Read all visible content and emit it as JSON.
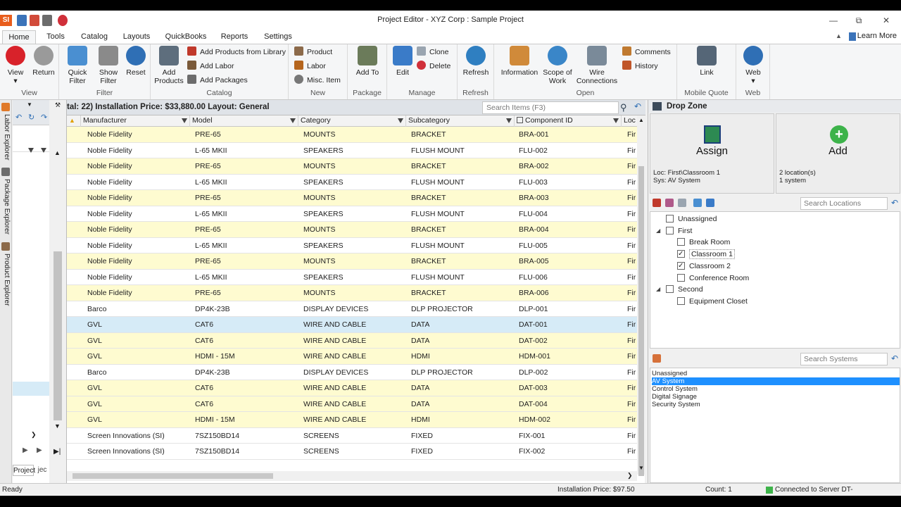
{
  "window": {
    "title": "Project Editor - XYZ Corp : Sample Project",
    "logo_text": "SI",
    "learn_more": "Learn More"
  },
  "tabs": [
    "Home",
    "Tools",
    "Catalog",
    "Layouts",
    "QuickBooks",
    "Reports",
    "Settings"
  ],
  "ribbon": {
    "view": {
      "view": "View",
      "return": "Return",
      "group": "View"
    },
    "filter": {
      "quick": "Quick Filter",
      "show": "Show Filter",
      "reset": "Reset",
      "group": "Filter"
    },
    "catalog": {
      "add_products": "Add Products",
      "from_library": "Add Products from Library",
      "add_labor": "Add Labor",
      "add_packages": "Add Packages",
      "group": "Catalog"
    },
    "new": {
      "product": "Product",
      "labor": "Labor",
      "misc": "Misc. Item",
      "group": "New"
    },
    "package": {
      "add_to": "Add To",
      "group": "Package"
    },
    "manage": {
      "edit": "Edit",
      "clone": "Clone",
      "delete": "Delete",
      "group": "Manage"
    },
    "refresh": {
      "refresh": "Refresh",
      "group": "Refresh"
    },
    "open": {
      "information": "Information",
      "scope": "Scope of Work",
      "wire": "Wire Connections",
      "comments": "Comments",
      "history": "History",
      "group": "Open"
    },
    "mobile": {
      "link": "Link",
      "group": "Mobile Quote"
    },
    "web": {
      "web": "Web",
      "group": "Web"
    }
  },
  "left_tabs": [
    "Labor Explorer",
    "Package Explorer",
    "Product Explorer"
  ],
  "left_bottom_tabs": [
    "Project",
    "jec"
  ],
  "grid": {
    "summary": "tal: 22)   Installation Price: $33,880.00   Layout: General",
    "search_placeholder": "Search Items (F3)",
    "columns": [
      "Manufacturer",
      "Model",
      "Category",
      "Subcategory",
      "Component ID",
      "Loc"
    ],
    "rows": [
      {
        "style": "yellow",
        "cells": [
          "Noble Fidelity",
          "PRE-65",
          "MOUNTS",
          "BRACKET",
          "BRA-001",
          "Fir"
        ]
      },
      {
        "style": "white",
        "cells": [
          "Noble Fidelity",
          "L-65 MKII",
          "SPEAKERS",
          "FLUSH MOUNT",
          "FLU-002",
          "Fir"
        ]
      },
      {
        "style": "yellow",
        "cells": [
          "Noble Fidelity",
          "PRE-65",
          "MOUNTS",
          "BRACKET",
          "BRA-002",
          "Fir"
        ]
      },
      {
        "style": "white",
        "cells": [
          "Noble Fidelity",
          "L-65 MKII",
          "SPEAKERS",
          "FLUSH MOUNT",
          "FLU-003",
          "Fir"
        ]
      },
      {
        "style": "yellow",
        "cells": [
          "Noble Fidelity",
          "PRE-65",
          "MOUNTS",
          "BRACKET",
          "BRA-003",
          "Fir"
        ]
      },
      {
        "style": "white",
        "cells": [
          "Noble Fidelity",
          "L-65 MKII",
          "SPEAKERS",
          "FLUSH MOUNT",
          "FLU-004",
          "Fir"
        ]
      },
      {
        "style": "yellow",
        "cells": [
          "Noble Fidelity",
          "PRE-65",
          "MOUNTS",
          "BRACKET",
          "BRA-004",
          "Fir"
        ]
      },
      {
        "style": "white",
        "cells": [
          "Noble Fidelity",
          "L-65 MKII",
          "SPEAKERS",
          "FLUSH MOUNT",
          "FLU-005",
          "Fir"
        ]
      },
      {
        "style": "yellow",
        "cells": [
          "Noble Fidelity",
          "PRE-65",
          "MOUNTS",
          "BRACKET",
          "BRA-005",
          "Fir"
        ]
      },
      {
        "style": "white",
        "cells": [
          "Noble Fidelity",
          "L-65 MKII",
          "SPEAKERS",
          "FLUSH MOUNT",
          "FLU-006",
          "Fir"
        ]
      },
      {
        "style": "yellow",
        "cells": [
          "Noble Fidelity",
          "PRE-65",
          "MOUNTS",
          "BRACKET",
          "BRA-006",
          "Fir"
        ]
      },
      {
        "style": "white",
        "cells": [
          "Barco",
          "DP4K-23B",
          "DISPLAY DEVICES",
          "DLP PROJECTOR",
          "DLP-001",
          "Fir"
        ]
      },
      {
        "style": "selected",
        "cells": [
          "GVL",
          "CAT6",
          "WIRE AND CABLE",
          "DATA",
          "DAT-001",
          "Fir"
        ]
      },
      {
        "style": "yellow",
        "cells": [
          "GVL",
          "CAT6",
          "WIRE AND CABLE",
          "DATA",
          "DAT-002",
          "Fir"
        ]
      },
      {
        "style": "yellow",
        "cells": [
          "GVL",
          "HDMI - 15M",
          "WIRE AND CABLE",
          "HDMI",
          "HDM-001",
          "Fir"
        ]
      },
      {
        "style": "white",
        "cells": [
          "Barco",
          "DP4K-23B",
          "DISPLAY DEVICES",
          "DLP PROJECTOR",
          "DLP-002",
          "Fir"
        ]
      },
      {
        "style": "yellow",
        "cells": [
          "GVL",
          "CAT6",
          "WIRE AND CABLE",
          "DATA",
          "DAT-003",
          "Fir"
        ]
      },
      {
        "style": "yellow",
        "cells": [
          "GVL",
          "CAT6",
          "WIRE AND CABLE",
          "DATA",
          "DAT-004",
          "Fir"
        ]
      },
      {
        "style": "yellow",
        "cells": [
          "GVL",
          "HDMI - 15M",
          "WIRE AND CABLE",
          "HDMI",
          "HDM-002",
          "Fir"
        ]
      },
      {
        "style": "white",
        "cells": [
          "Screen Innovations (SI)",
          "7SZ150BD14",
          "SCREENS",
          "FIXED",
          "FIX-001",
          "Fir"
        ]
      },
      {
        "style": "white",
        "cells": [
          "Screen Innovations (SI)",
          "7SZ150BD14",
          "SCREENS",
          "FIXED",
          "FIX-002",
          "Fir"
        ]
      }
    ]
  },
  "dropzone": {
    "title": "Drop Zone",
    "assign": {
      "label": "Assign",
      "loc": "Loc: First\\Classroom 1",
      "sys": "Sys: AV System"
    },
    "add": {
      "label": "Add",
      "locs": "2 location(s)",
      "sys": "1 system"
    },
    "search_locations": "Search Locations",
    "search_systems": "Search Systems",
    "locations": [
      {
        "label": "Unassigned",
        "level": 0,
        "checked": false,
        "expand": ""
      },
      {
        "label": "First",
        "level": 0,
        "checked": false,
        "expand": "◢"
      },
      {
        "label": "Break Room",
        "level": 1,
        "checked": false,
        "expand": ""
      },
      {
        "label": "Classroom 1",
        "level": 1,
        "checked": true,
        "expand": ""
      },
      {
        "label": "Classroom 2",
        "level": 1,
        "checked": true,
        "expand": ""
      },
      {
        "label": "Conference Room",
        "level": 1,
        "checked": false,
        "expand": ""
      },
      {
        "label": "Second",
        "level": 0,
        "checked": false,
        "expand": "◢"
      },
      {
        "label": "Equipment Closet",
        "level": 1,
        "checked": false,
        "expand": ""
      }
    ],
    "systems": [
      {
        "label": "Unassigned",
        "selected": false
      },
      {
        "label": "AV System",
        "selected": true
      },
      {
        "label": "Control System",
        "selected": false
      },
      {
        "label": "Digital Signage",
        "selected": false
      },
      {
        "label": "Security System",
        "selected": false
      }
    ]
  },
  "status": {
    "ready": "Ready",
    "install_price": "Installation Price: $97.50",
    "count": "Count: 1",
    "connection": "Connected to Server DT-SENOSLAPTOP"
  }
}
